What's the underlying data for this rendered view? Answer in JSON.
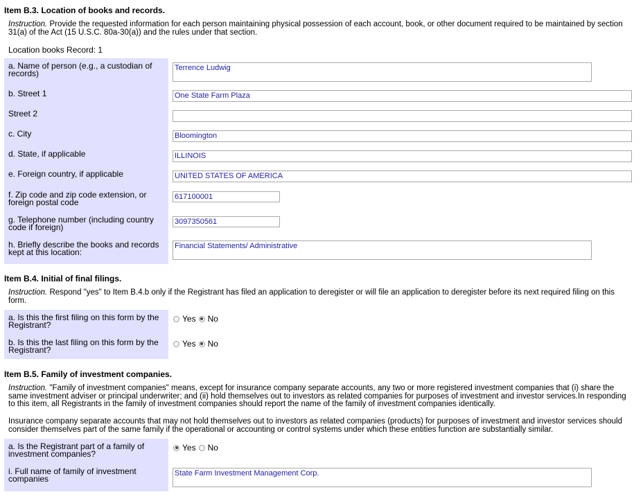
{
  "b3": {
    "heading": "Item B.3. Location of books and records.",
    "instruction_prefix": "Instruction.",
    "instruction_text": " Provide the requested information for each person maintaining physical possession of each account, book, or other document required to be maintained by section 31(a) of the Act (15 U.S.C. 80a-30(a)) and the rules under that section.",
    "record_label": "Location books Record: 1",
    "fields": {
      "name": {
        "label": "a. Name of person (e.g., a custodian of records)",
        "value": "Terrence Ludwig"
      },
      "street1": {
        "label": "b. Street 1",
        "value": "One State Farm Plaza"
      },
      "street2": {
        "label": "Street 2",
        "value": ""
      },
      "city": {
        "label": "c. City",
        "value": "Bloomington"
      },
      "state": {
        "label": "d. State, if applicable",
        "value": "ILLINOIS"
      },
      "country": {
        "label": "e. Foreign country, if applicable",
        "value": "UNITED STATES OF AMERICA"
      },
      "zip": {
        "label": "f. Zip code and zip code extension, or foreign postal code",
        "value": "617100001"
      },
      "phone": {
        "label": "g. Telephone number (including country code if foreign)",
        "value": "3097350561"
      },
      "books": {
        "label": "h. Briefly describe the books and records kept at this location:",
        "value": "Financial Statements/ Administrative"
      }
    }
  },
  "b4": {
    "heading": "Item B.4. Initial of final filings.",
    "instruction_prefix": "Instruction.",
    "instruction_text": " Respond \"yes\" to Item B.4.b only if the Registrant has filed an application to deregister or will file an application to deregister before its next required filing on this form.",
    "q_first": {
      "label": "a. Is this the first filing on this form by the Registrant?",
      "selected": "No"
    },
    "q_last": {
      "label": "b. Is this the last filing on this form by the Registrant?",
      "selected": "No"
    }
  },
  "b5": {
    "heading": "Item B.5. Family of investment companies.",
    "instruction_prefix": "Instruction.",
    "instruction_text": " \"Family of investment companies\" means, except for insurance company separate accounts, any two or more registered investment companies that (i) share the same investment adviser or principal underwriter; and (ii) hold themselves out to investors as related companies for purposes of investment and investor services.In responding to this item, all Registrants in the family of investment companies should report the name of the family of investment companies identically.",
    "note": "Insurance company separate accounts that may not hold themselves out to investors as related companies (products) for purposes of investment and investor services should consider themselves part of the same family if the operational or accounting or control systems under which these entities function are substantially similar.",
    "q_family": {
      "label": "a. Is the Registrant part of a family of investment companies?",
      "selected": "Yes"
    },
    "family_name": {
      "label": "i. Full name of family of investment companies",
      "value": "State Farm Investment Management Corp."
    }
  },
  "options": {
    "yes": "Yes",
    "no": "No"
  }
}
